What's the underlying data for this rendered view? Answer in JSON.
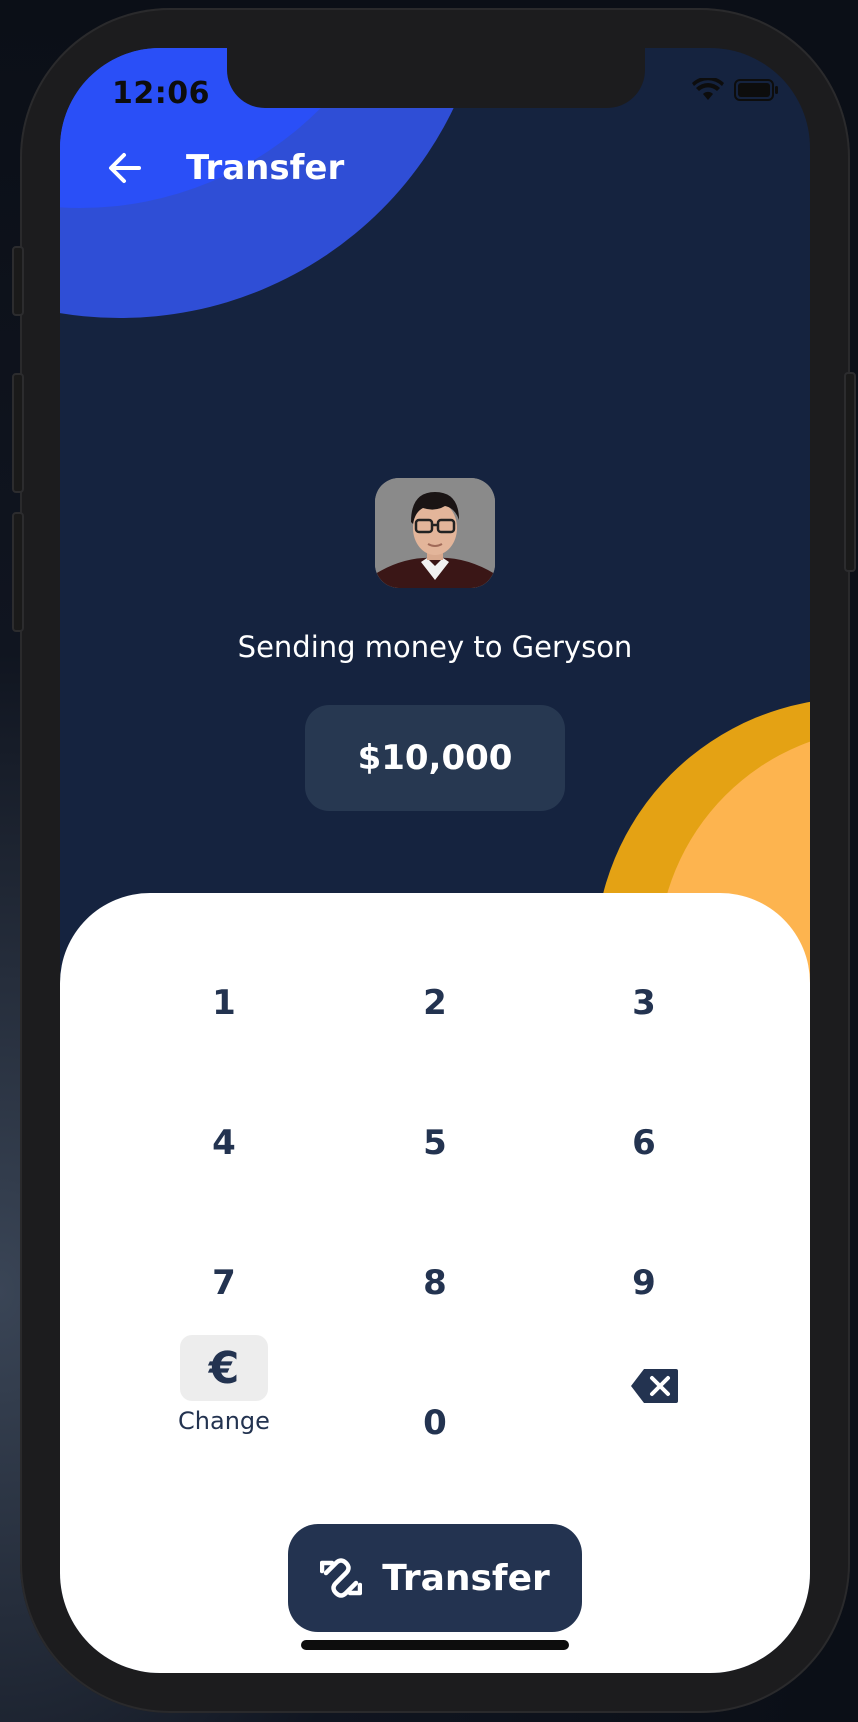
{
  "status_bar": {
    "time": "12:06",
    "icons": [
      "wifi-icon",
      "battery-icon"
    ]
  },
  "header": {
    "back_icon": "arrow-left-icon",
    "title": "Transfer"
  },
  "recipient": {
    "avatar": "recipient-avatar",
    "sending_text": "Sending money to Geryson"
  },
  "amount": {
    "value": "$10,000"
  },
  "keypad": {
    "keys": [
      "1",
      "2",
      "3",
      "4",
      "5",
      "6",
      "7",
      "8",
      "9",
      "0"
    ],
    "change_symbol": "€",
    "change_label": "Change",
    "backspace_icon": "backspace-icon"
  },
  "transfer_button": {
    "icon": "transfer-icon",
    "label": "Transfer"
  },
  "colors": {
    "background": "#15233f",
    "accent_blue": "#2a4ff7",
    "accent_orange": "#fdb44f",
    "primary_dark": "#233350",
    "amount_box": "#273851"
  }
}
